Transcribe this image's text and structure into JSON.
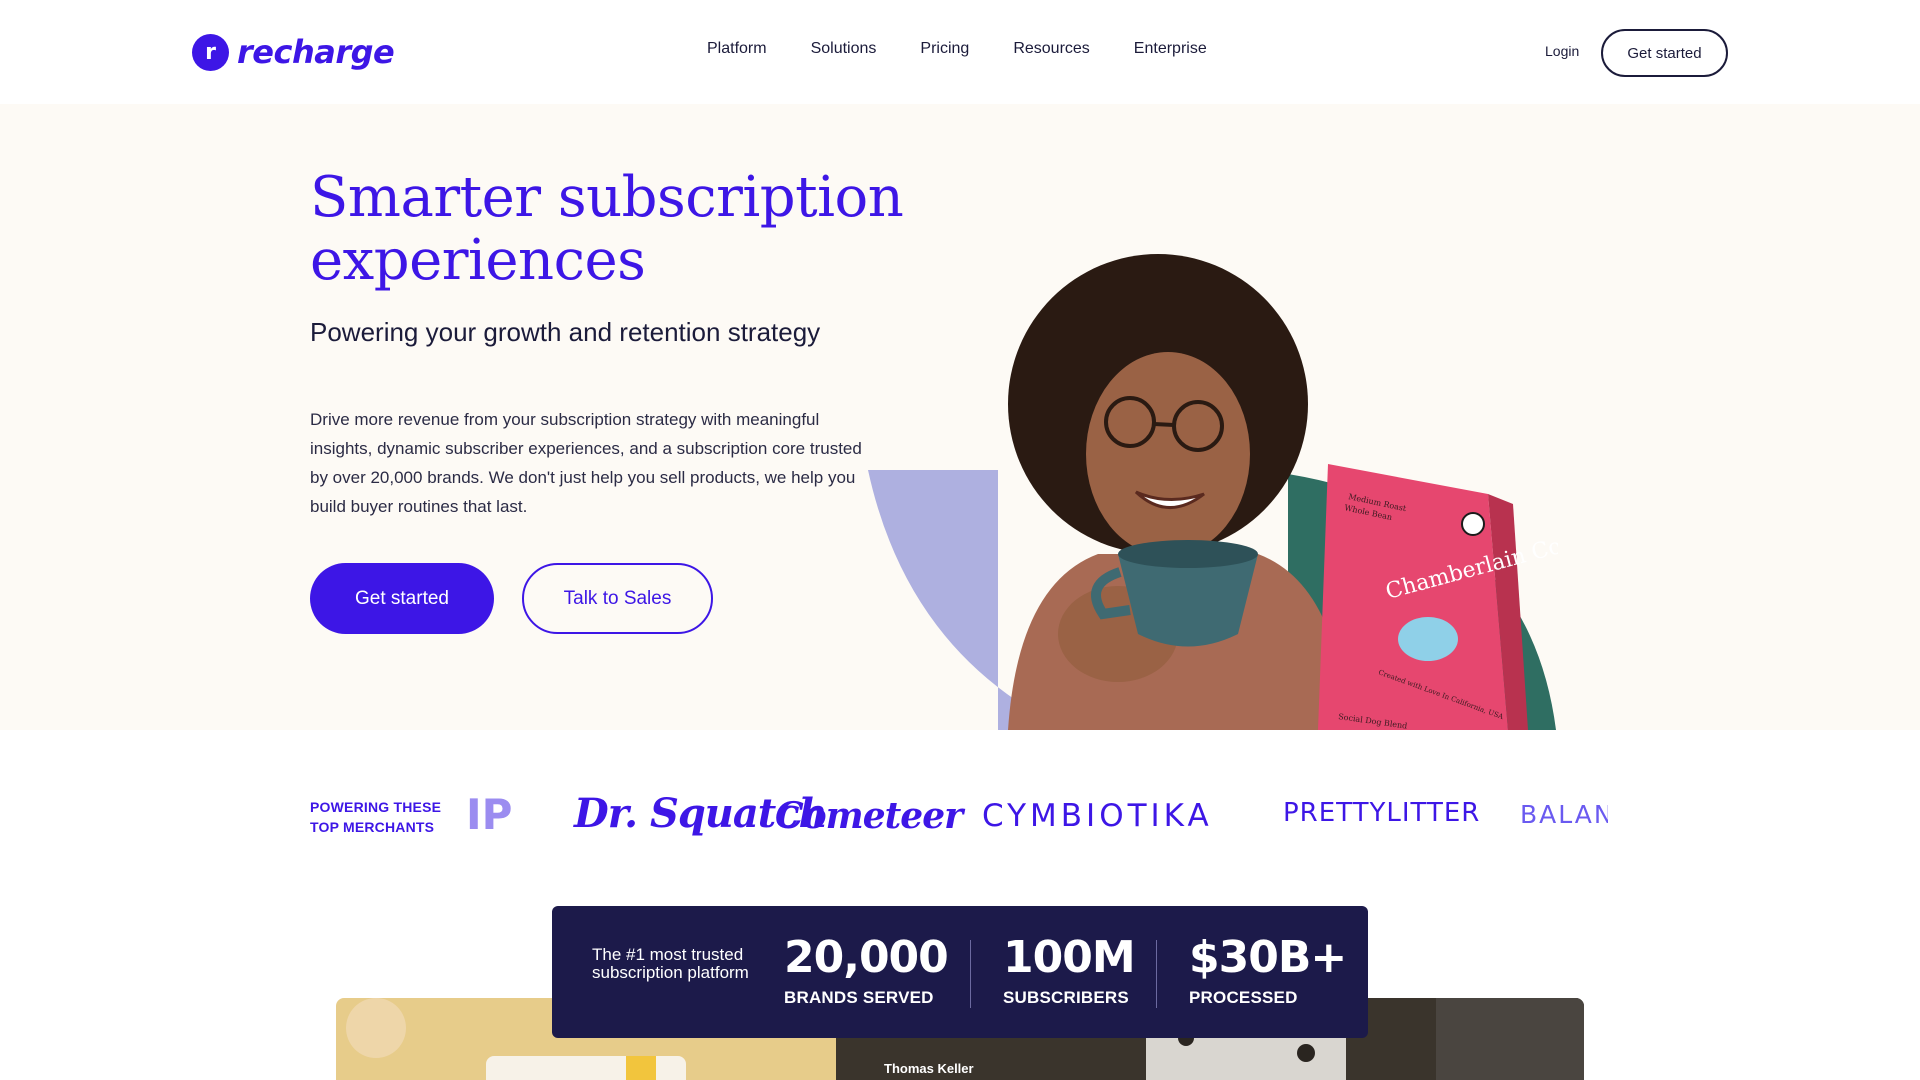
{
  "header": {
    "brand": "recharge",
    "nav": [
      "Platform",
      "Solutions",
      "Pricing",
      "Resources",
      "Enterprise"
    ],
    "login": "Login",
    "cta": "Get started"
  },
  "hero": {
    "title": "Smarter subscription experiences",
    "subtitle": "Powering your growth and retention strategy",
    "body": "Drive more revenue from your subscription strategy with meaningful insights, dynamic subscriber experiences, and a subscription core trusted by over 20,000 brands. We don't just help you sell products, we help you build buyer routines that last.",
    "primary_button": "Get started",
    "secondary_button": "Talk to Sales",
    "product_bag": {
      "brand": "Chamberlain Coffee",
      "roast": "Medium Roast",
      "type": "Whole Bean",
      "tagline": "Created with Love In California, USA",
      "blend": "Social Dog Blend"
    }
  },
  "merchants": {
    "label": "POWERING THESE TOP MERCHANTS",
    "logos": [
      "IP",
      "Dr. Squatch",
      "Cometeer",
      "CYMBIOTIKA",
      "PRETTYLITTER",
      "BALAN"
    ]
  },
  "stats": {
    "intro": "The #1 most trusted subscription platform",
    "items": [
      {
        "value": "20,000",
        "label": "BRANDS SERVED"
      },
      {
        "value": "100M",
        "label": "SUBSCRIBERS"
      },
      {
        "value": "$30B+",
        "label": "PROCESSED"
      }
    ]
  },
  "caption": "Thomas Keller",
  "colors": {
    "brand": "#3d16e6",
    "navy": "#1c1a4a",
    "hero_bg": "#fdfaf5",
    "lavender": "#aeb0e0",
    "teal": "#2f6e62",
    "bag_pink": "#e6476f"
  }
}
